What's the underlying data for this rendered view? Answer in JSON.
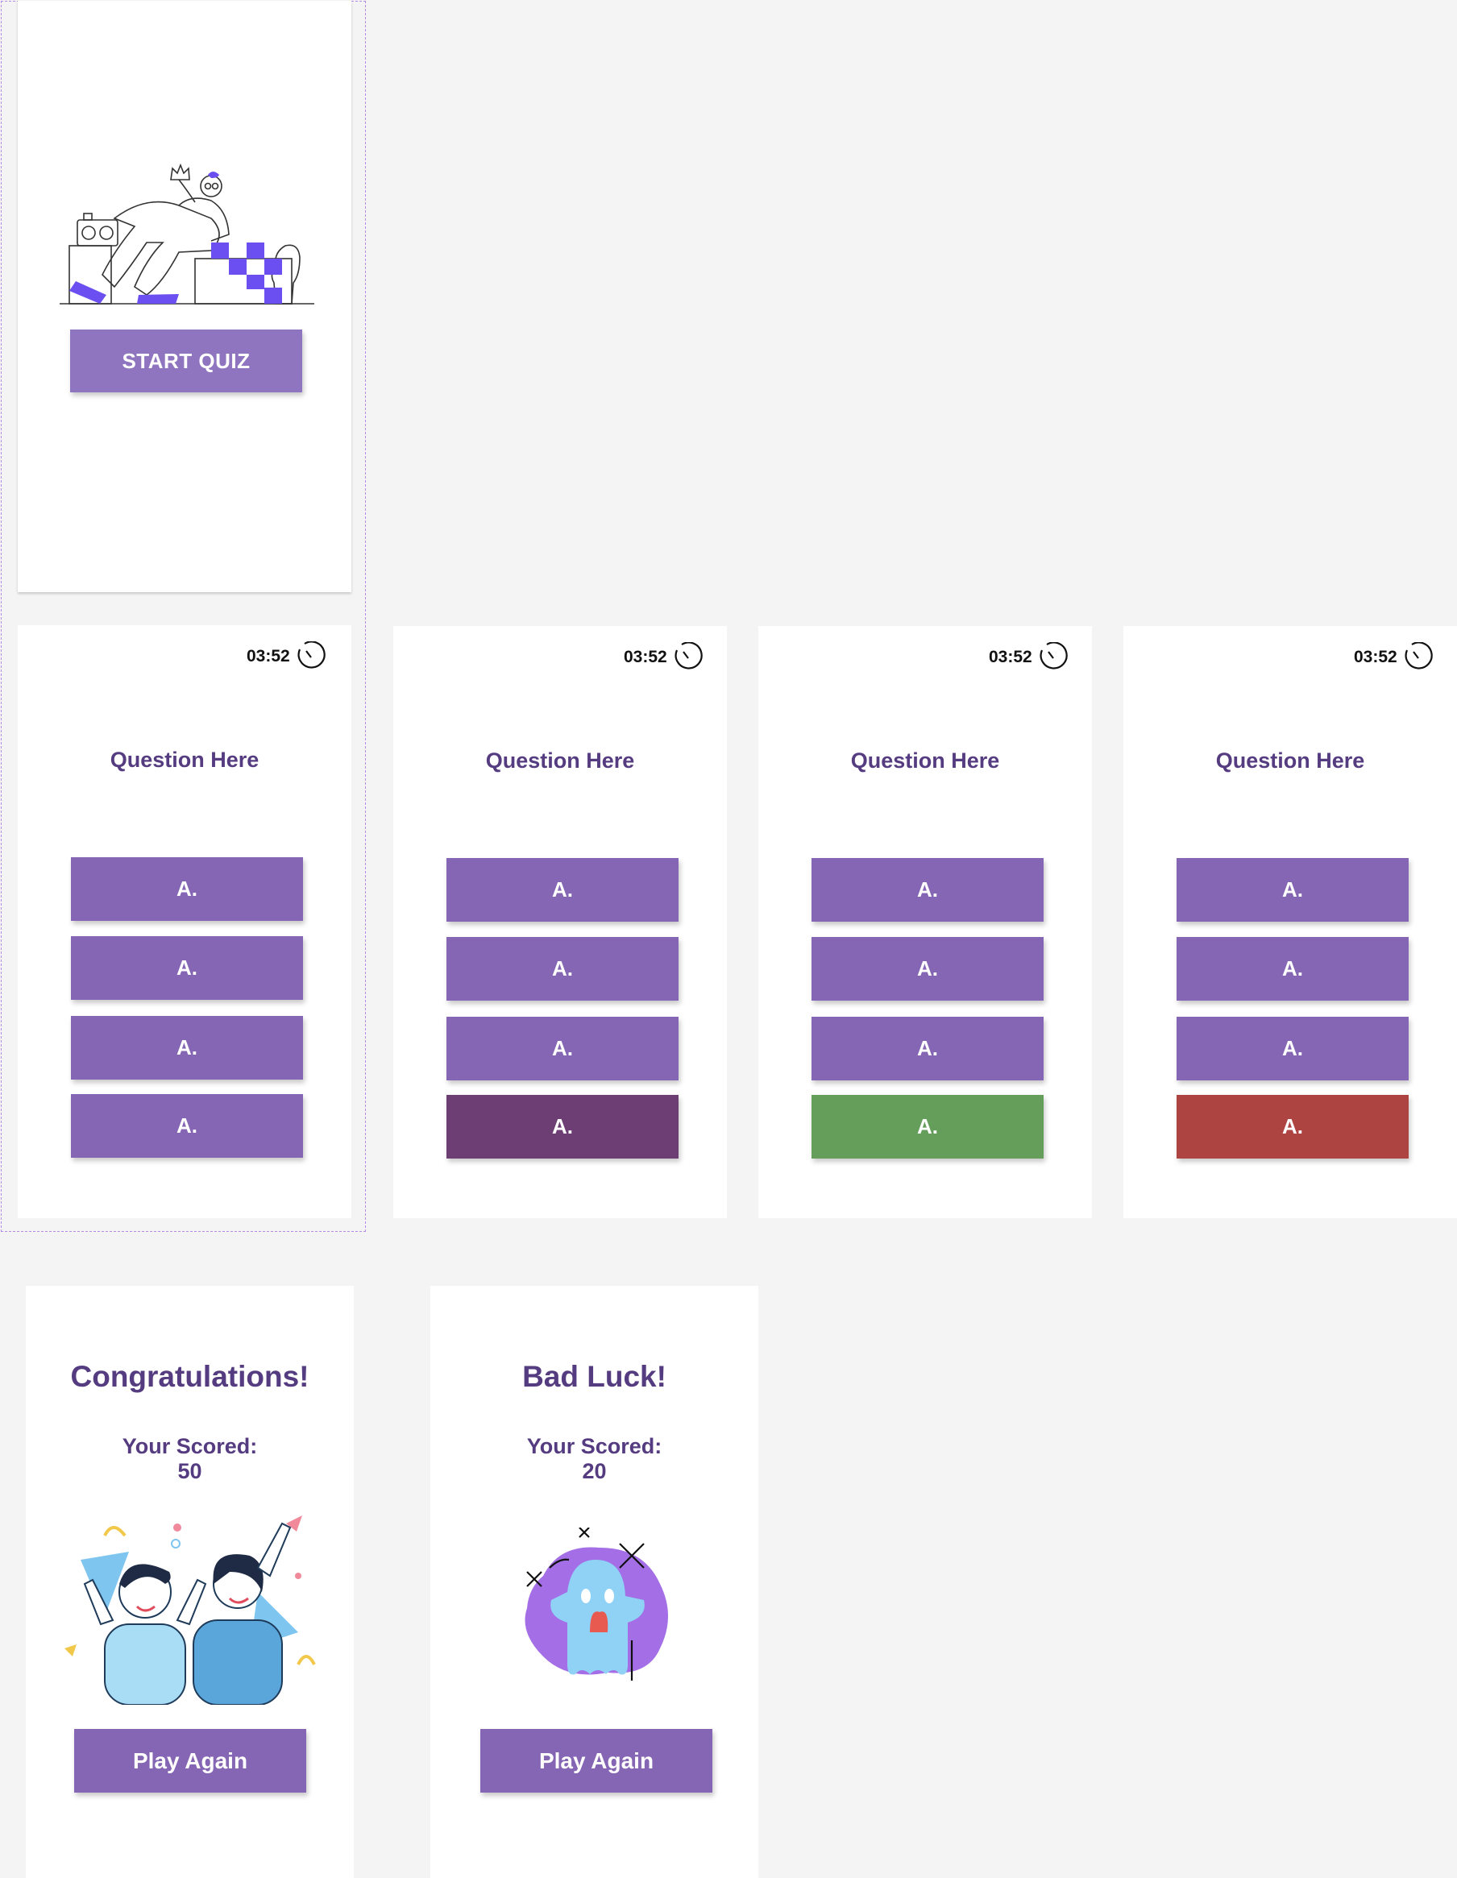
{
  "colors": {
    "primary": "#8566b4",
    "start_button": "#8f75bf",
    "selected": "#6d3e74",
    "correct": "#659e5a",
    "wrong": "#ad4442",
    "heading": "#553c80",
    "selection_outline": "#b48be0"
  },
  "start_screen": {
    "start_button_label": "START QUIZ",
    "illustration_icon": "chess-player-illustration"
  },
  "question_screens": [
    {
      "state": "default",
      "timer": "03:52",
      "question": "Question Here",
      "answers": [
        "A.",
        "A.",
        "A.",
        "A."
      ]
    },
    {
      "state": "selected",
      "timer": "03:52",
      "question": "Question Here",
      "answers": [
        "A.",
        "A.",
        "A.",
        "A."
      ]
    },
    {
      "state": "correct",
      "timer": "03:52",
      "question": "Question Here",
      "answers": [
        "A.",
        "A.",
        "A.",
        "A."
      ]
    },
    {
      "state": "wrong",
      "timer": "03:52",
      "question": "Question Here",
      "answers": [
        "A.",
        "A.",
        "A.",
        "A."
      ]
    }
  ],
  "result_screens": [
    {
      "title": "Congratulations!",
      "score_label": "Your Scored:",
      "score": "50",
      "button_label": "Play Again",
      "illustration_icon": "celebration-illustration"
    },
    {
      "title": "Bad Luck!",
      "score_label": "Your Scored:",
      "score": "20",
      "button_label": "Play Again",
      "illustration_icon": "ghost-illustration"
    }
  ]
}
